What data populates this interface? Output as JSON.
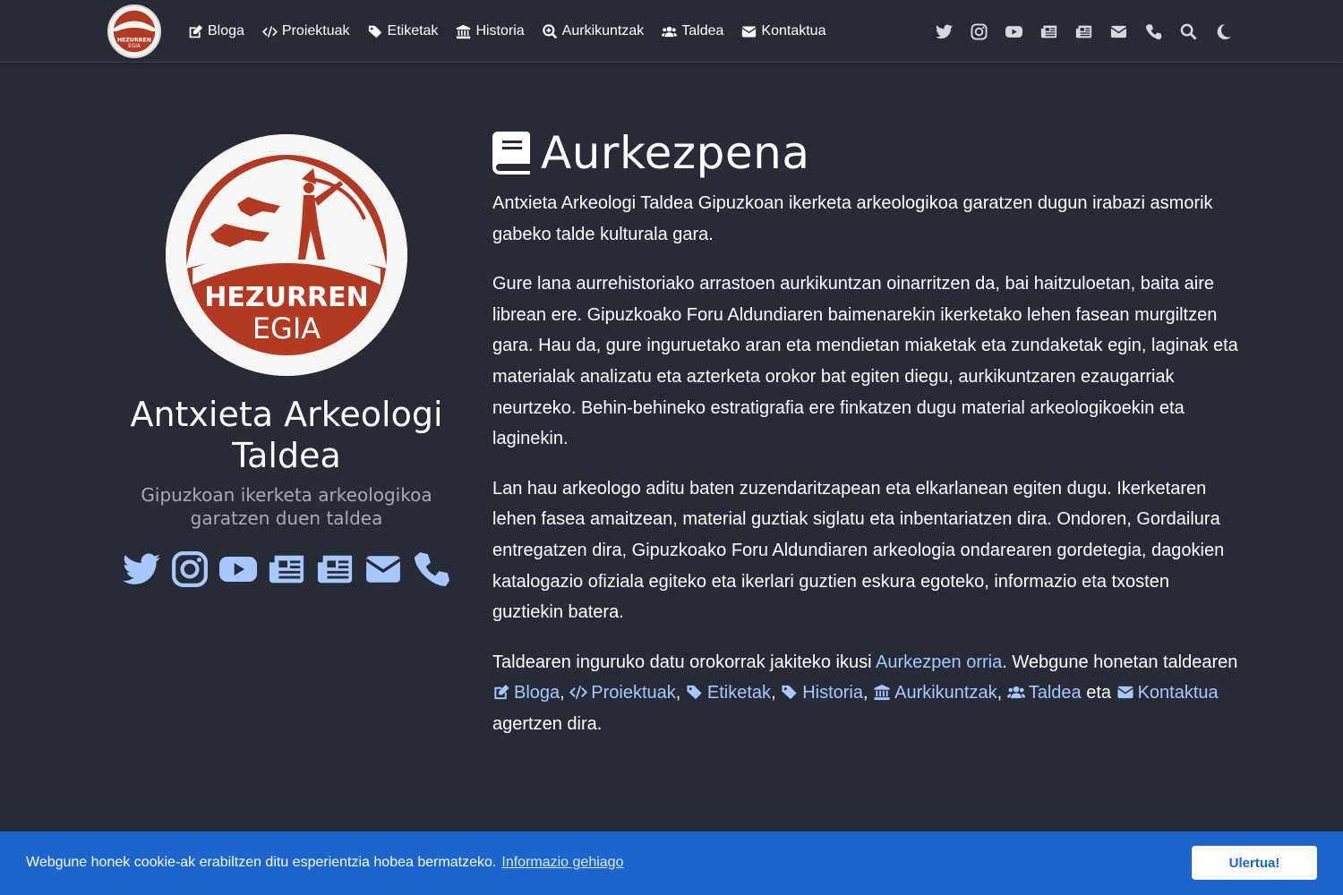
{
  "nav": {
    "links": [
      {
        "label": "Bloga",
        "icon": "edit-icon"
      },
      {
        "label": "Proiektuak",
        "icon": "code-icon"
      },
      {
        "label": "Etiketak",
        "icon": "tags-icon"
      },
      {
        "label": "Historia",
        "icon": "landmark-icon"
      },
      {
        "label": "Aurkikuntzak",
        "icon": "search-plus-icon"
      },
      {
        "label": "Taldea",
        "icon": "users-icon"
      },
      {
        "label": "Kontaktua",
        "icon": "envelope-icon"
      }
    ],
    "right_icons": [
      "twitter-icon",
      "instagram-icon",
      "youtube-icon",
      "newspaper-icon",
      "newspaper-icon",
      "envelope-icon",
      "phone-icon",
      "search-icon",
      "moon-icon"
    ]
  },
  "logo": {
    "line1": "HEZURREN",
    "line2": "EGIA"
  },
  "profile": {
    "name": "Antxieta Arkeologi Taldea",
    "tagline": "Gipuzkoan ikerketa arkeologikoa garatzen duen taldea",
    "social_icons": [
      "twitter-icon",
      "instagram-icon",
      "youtube-icon",
      "newspaper-icon",
      "newspaper-icon",
      "envelope-icon",
      "phone-icon"
    ]
  },
  "main": {
    "title": "Aurkezpena",
    "p1": "Antxieta Arkeologi Taldea Gipuzkoan ikerketa arkeologikoa garatzen dugun irabazi asmorik gabeko talde kulturala gara.",
    "p2": "Gure lana aurrehistoriako arrastoen aurkikuntzan oinarritzen da, bai haitzuloetan, baita aire librean ere. Gipuzkoako Foru Aldundiaren baimenarekin ikerketako lehen fasean murgiltzen gara. Hau da, gure inguruetako aran eta mendietan miaketak eta zundaketak egin, laginak eta materialak analizatu eta azterketa orokor bat egiten diegu, aurkikuntzaren ezaugarriak neurtzeko. Behin-behineko estratigrafia ere finkatzen dugu material arkeologikoekin eta laginekin.",
    "p3": "Lan hau arkeologo aditu baten zuzendaritzapean eta elkarlanean egiten dugu. Ikerketaren lehen fasea amaitzean, material guztiak siglatu eta inbentariatzen dira. Ondoren, Gordailura entregatzen dira, Gipuzkoako Foru Aldundiaren arkeologia ondarearen gordetegia, dagokien katalogazio ofiziala egiteko eta ikerlari guztien eskura egoteko, informazio eta txosten guztiekin batera.",
    "p4": {
      "before": "Taldearen inguruko datu orokorrak jakiteko ikusi ",
      "link": "Aurkezpen orria",
      "middle": ". Webgune honetan taldearen ",
      "links": [
        "Bloga",
        "Proiektuak",
        "Etiketak",
        "Historia",
        "Aurkikuntzak",
        "Taldea",
        "Kontaktua"
      ],
      "sep": ", ",
      "and": " eta ",
      "after": " agertzen dira."
    }
  },
  "cookie": {
    "text": "Webgune honek cookie-ak erabiltzen ditu esperientzia hobea bermatzeko.",
    "link": "Informazio gehiago",
    "button": "Ulertua!"
  },
  "colors": {
    "background": "#272a37",
    "link": "#a7c8ff",
    "cookie_bg": "#1c65cc",
    "logo_red": "#b23a22"
  }
}
